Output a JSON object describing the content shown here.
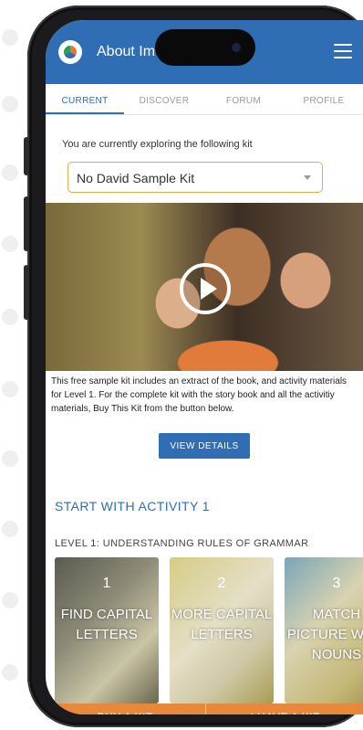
{
  "app": {
    "title": "About Im",
    "logo_icon": "app-logo-icon",
    "menu_icon": "hamburger-menu-icon",
    "accent_color": "#2f6db5",
    "cta_color": "#e8883a"
  },
  "tabs": [
    {
      "label": "CURRENT",
      "active": true
    },
    {
      "label": "DISCOVER",
      "active": false
    },
    {
      "label": "FORUM",
      "active": false
    },
    {
      "label": "PROFILE",
      "active": false
    }
  ],
  "kit": {
    "intro": "You are currently exploring the following kit",
    "selected": "No David Sample Kit",
    "description": "This free sample kit includes an extract of the book, and activity materials for Level 1. For the complete kit with the story book and all the activitiy materials, Buy This Kit from the button below.",
    "view_details": "VIEW DETAILS"
  },
  "video": {
    "play_icon": "play-icon"
  },
  "activity": {
    "section_title": "START WITH ACTIVITY 1",
    "level_title": "LEVEL 1: UNDERSTANDING RULES OF GRAMMAR",
    "cards": [
      {
        "number": "1",
        "title": "FIND CAPITAL LETTERS"
      },
      {
        "number": "2",
        "title": "MORE CAPITAL LETTERS"
      },
      {
        "number": "3",
        "title": "MATCH PICTURE WITH NOUNS"
      }
    ]
  },
  "bottom_bar": {
    "buy": "BUY A KIT",
    "have": "I HAVE A KIT"
  }
}
